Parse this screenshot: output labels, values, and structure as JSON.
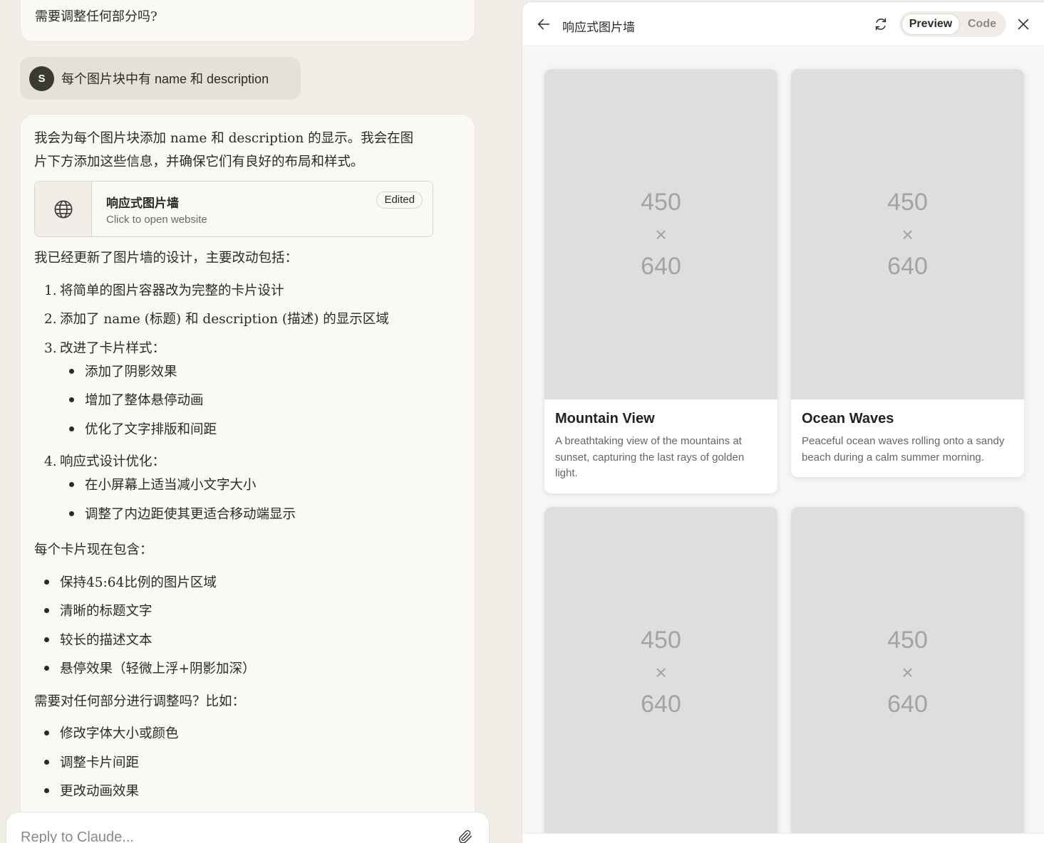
{
  "chat": {
    "previous_message": "需要调整任何部分吗?",
    "user": {
      "avatar_initial": "S",
      "message": "每个图片块中有 name 和 description"
    },
    "assistant": {
      "intro_line1": "我会为每个图片块添加 name 和 description 的显示。我会在图",
      "intro_line2": "片下方添加这些信息，并确保它们有良好的布局和样式。",
      "artifact": {
        "icon": "globe-icon",
        "title": "响应式图片墙",
        "subtitle": "Click to open website",
        "badge": "Edited"
      },
      "summary_heading": "我已经更新了图片墙的设计，主要改动包括：",
      "numbered": [
        {
          "num": "1.",
          "text": "将简单的图片容器改为完整的卡片设计"
        },
        {
          "num": "2.",
          "text": "添加了 name (标题) 和 description (描述) 的显示区域"
        },
        {
          "num": "3.",
          "text": "改进了卡片样式："
        },
        {
          "num": "4.",
          "text": "响应式设计优化："
        }
      ],
      "sub_list_3": [
        "添加了阴影效果",
        "增加了整体悬停动画",
        "优化了文字排版和间距"
      ],
      "sub_list_4": [
        "在小屏幕上适当减小文字大小",
        "调整了内边距使其更适合移动端显示"
      ],
      "card_heading": "每个卡片现在包含：",
      "card_items": [
        "保持45:64比例的图片区域",
        "清晰的标题文字",
        "较长的描述文本",
        "悬停效果（轻微上浮+阴影加深）"
      ],
      "question": "需要对任何部分进行调整吗？比如：",
      "suggestions": [
        "修改字体大小或颜色",
        "调整卡片间距",
        "更改动画效果"
      ]
    },
    "reply": {
      "placeholder": "Reply to Claude..."
    }
  },
  "panel": {
    "title": "响应式图片墙",
    "toggle": {
      "preview": "Preview",
      "code": "Code",
      "active": "preview"
    },
    "cards": [
      {
        "w": "450",
        "x": "×",
        "h": "640",
        "name": "Mountain View",
        "desc": "A breathtaking view of the mountains at sunset, capturing the last rays of golden light."
      },
      {
        "w": "450",
        "x": "×",
        "h": "640",
        "name": "Ocean Waves",
        "desc": "Peaceful ocean waves rolling onto a sandy beach during a calm summer morning."
      },
      {
        "w": "450",
        "x": "×",
        "h": "640"
      },
      {
        "w": "450",
        "x": "×",
        "h": "640"
      }
    ]
  },
  "colors": {
    "background": "#f0eee6",
    "placeholder_gray": "#dedede",
    "avatar": "#3a3a30"
  }
}
